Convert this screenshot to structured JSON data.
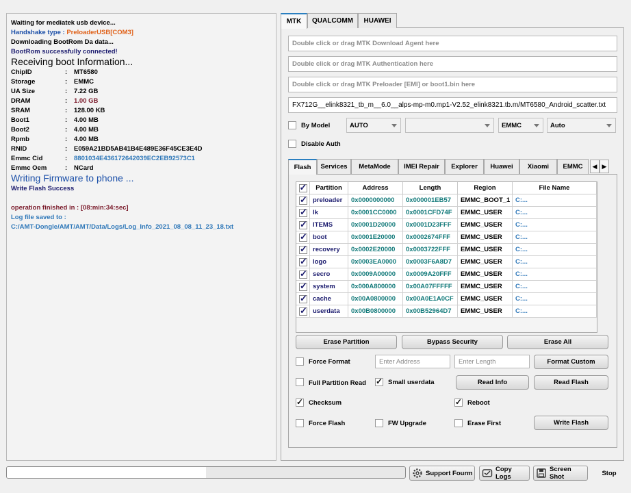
{
  "log": {
    "lines": [
      {
        "text": "Waiting for mediatek usb device...",
        "color": "#000000"
      },
      {
        "label": "Handshake type : ",
        "value": "PreloaderUSB[COM3]",
        "label_color": "#1b4fa8",
        "value_color": "#e0621a"
      },
      {
        "text": "Downloading BootRom Da data...",
        "color": "#000000"
      },
      {
        "text": "BootRom successfully connected!",
        "color": "#1b1b6e"
      },
      {
        "text": "Receiving boot Information...",
        "color": "#000000"
      }
    ],
    "info": [
      {
        "key": "ChipID",
        "sep": ":",
        "value": "MT6580",
        "color": "#000000"
      },
      {
        "key": "Storage",
        "sep": ":",
        "value": "EMMC",
        "color": "#000000"
      },
      {
        "key": "UA Size",
        "sep": ":",
        "value": "7.22 GB",
        "color": "#000000"
      },
      {
        "key": "DRAM",
        "sep": ":",
        "value": "1.00 GB",
        "color": "#7a1a2a"
      },
      {
        "key": "SRAM",
        "sep": ":",
        "value": "128.00 KB",
        "color": "#000000"
      },
      {
        "key": "Boot1",
        "sep": ":",
        "value": "4.00 MB",
        "color": "#000000"
      },
      {
        "key": "Boot2",
        "sep": ":",
        "value": "4.00 MB",
        "color": "#000000"
      },
      {
        "key": "Rpmb",
        "sep": ":",
        "value": "4.00 MB",
        "color": "#000000"
      },
      {
        "key": "RNID",
        "sep": ":",
        "value": "E059A21BD5AB41B4E489E36F45CE3E4D",
        "color": "#000000"
      },
      {
        "key": "Emmc Cid",
        "sep": ":",
        "value": "8801034E436172642039EC2EB92573C1",
        "color": "#2f78b9"
      },
      {
        "key": "Emmc Oem",
        "sep": ":",
        "value": "NCard",
        "color": "#000000"
      }
    ],
    "writing": "Writing Firmware to phone ...",
    "write_success": "Write Flash Success",
    "finished_label": "operation finished in : ",
    "finished_value": "[08:min:34:sec]",
    "log_saved": "Log file saved to :",
    "log_path": "C:/AMT-Dongle/AMT/AMT/Data/Logs/Log_Info_2021_08_08_11_23_18.txt"
  },
  "top_tabs": [
    "MTK",
    "QUALCOMM",
    "HUAWEI"
  ],
  "files": {
    "da_placeholder": "Double click or drag MTK Download Agent here",
    "auth_placeholder": "Double click or drag MTK Authentication here",
    "preloader_placeholder": "Double click or drag MTK Preloader [EMI] or boot1.bin here",
    "scatter_value": "FX712G__elink8321_tb_m__6.0__alps-mp-m0.mp1-V2.52_elink8321.tb.m/MT6580_Android_scatter.txt"
  },
  "options": {
    "by_model": "By Model",
    "model_combo": "AUTO",
    "model_combo2": "",
    "storage_combo": "EMMC",
    "auto_combo": "Auto",
    "disable_auth": "Disable Auth"
  },
  "inner_tabs": [
    "Flash",
    "Services",
    "MetaMode",
    "IMEI Repair",
    "Explorer",
    "Huawei",
    "Xiaomi",
    "EMMC"
  ],
  "table": {
    "headers": [
      "Partition",
      "Address",
      "Length",
      "Region",
      "File Name"
    ],
    "rows": [
      {
        "partition": "preloader",
        "address": "0x0000000000",
        "length": "0x000001EB57",
        "region": "EMMC_BOOT_1",
        "file": "C:..."
      },
      {
        "partition": "lk",
        "address": "0x0001CC0000",
        "length": "0x0001CFD74F",
        "region": "EMMC_USER",
        "file": "C:..."
      },
      {
        "partition": "ITEMS",
        "address": "0x0001D20000",
        "length": "0x0001D23FFF",
        "region": "EMMC_USER",
        "file": "C:..."
      },
      {
        "partition": "boot",
        "address": "0x0001E20000",
        "length": "0x0002674FFF",
        "region": "EMMC_USER",
        "file": "C:..."
      },
      {
        "partition": "recovery",
        "address": "0x0002E20000",
        "length": "0x0003722FFF",
        "region": "EMMC_USER",
        "file": "C:..."
      },
      {
        "partition": "logo",
        "address": "0x0003EA0000",
        "length": "0x0003F6A8D7",
        "region": "EMMC_USER",
        "file": "C:..."
      },
      {
        "partition": "secro",
        "address": "0x0009A00000",
        "length": "0x0009A20FFF",
        "region": "EMMC_USER",
        "file": "C:..."
      },
      {
        "partition": "system",
        "address": "0x000A800000",
        "length": "0x00A07FFFFF",
        "region": "EMMC_USER",
        "file": "C:..."
      },
      {
        "partition": "cache",
        "address": "0x00A0800000",
        "length": "0x00A0E1A0CF",
        "region": "EMMC_USER",
        "file": "C:..."
      },
      {
        "partition": "userdata",
        "address": "0x00B0800000",
        "length": "0x00B52964D7",
        "region": "EMMC_USER",
        "file": "C:..."
      }
    ]
  },
  "actions": {
    "erase_partition": "Erase Partition",
    "bypass_security": "Bypass Security",
    "erase_all": "Erase All",
    "force_format": "Force Format",
    "enter_address": "Enter Address",
    "enter_length": "Enter Length",
    "format_custom": "Format Custom",
    "full_partition_read": "Full Partition Read",
    "small_userdata": "Small userdata",
    "read_info": "Read Info",
    "read_flash": "Read Flash",
    "checksum": "Checksum",
    "reboot": "Reboot",
    "force_flash": "Force Flash",
    "fw_upgrade": "FW Upgrade",
    "erase_first": "Erase First",
    "write_flash": "Write Flash"
  },
  "checks": {
    "by_model": false,
    "disable_auth": false,
    "force_format": false,
    "full_partition_read": false,
    "small_userdata": true,
    "checksum": true,
    "reboot": true,
    "force_flash": false,
    "fw_upgrade": false,
    "erase_first": false
  },
  "bottom": {
    "progress": 0.5,
    "support_forum": "Support Fourm",
    "copy_logs": "Copy Logs",
    "screen_shot": "Screen Shot",
    "stop": "Stop"
  }
}
